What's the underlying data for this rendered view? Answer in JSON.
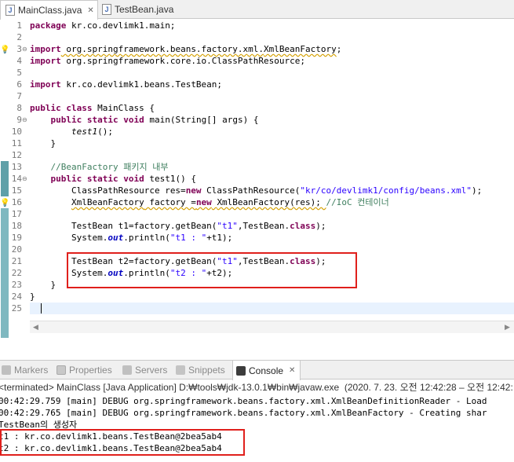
{
  "editor_tabs": [
    {
      "label": "MainClass.java",
      "close": "✕"
    },
    {
      "label": "TestBean.java"
    }
  ],
  "line_numbers": [
    "1",
    "2",
    "3",
    "4",
    "5",
    "6",
    "7",
    "8",
    "9",
    "10",
    "11",
    "12",
    "13",
    "14",
    "15",
    "16",
    "17",
    "18",
    "19",
    "20",
    "21",
    "22",
    "23",
    "24",
    "25"
  ],
  "code": {
    "l1": {
      "a": "package",
      "b": " kr.co.devlimk1.main;"
    },
    "l3": {
      "a": "import",
      "b": " org.springframework.beans.factory.xml.",
      "c": "XmlBeanFactory",
      "d": ";"
    },
    "l4": {
      "a": "import",
      "b": " org.springframework.core.io.ClassPathResource;"
    },
    "l6": {
      "a": "import",
      "b": " kr.co.devlimk1.beans.TestBean;"
    },
    "l8": {
      "a": "public",
      "b": "class",
      "c": " MainClass {"
    },
    "l9": {
      "indent": "    ",
      "a": "public",
      "b": "static",
      "c": "void",
      "d": " main(String[] args) {"
    },
    "l10": {
      "indent": "        ",
      "a": "test1",
      "b": "();"
    },
    "l11": {
      "text": "    }"
    },
    "l13": {
      "indent": "    ",
      "comment": "//BeanFactory 패키지 내부"
    },
    "l14": {
      "indent": "    ",
      "a": "public",
      "b": "static",
      "c": "void",
      "d": " test1() {"
    },
    "l15": {
      "indent": "        ",
      "a": "ClassPathResource res=",
      "b": "new",
      "c": " ClassPathResource(",
      "d": "\"kr/co/devlimk1/config/beans.xml\"",
      "e": ");"
    },
    "l16": {
      "indent": "        ",
      "a": "XmlBeanFactory",
      "b": " factory =",
      "c": "new",
      "d": " ",
      "e": "XmlBeanFactory",
      "f": "(res); ",
      "g": "//IoC 컨테이너"
    },
    "l18": {
      "indent": "        ",
      "a": "TestBean t1=factory.getBean(",
      "b": "\"t1\"",
      "c": ",TestBean.",
      "d": "class",
      "e": ");"
    },
    "l19": {
      "indent": "        ",
      "a": "System.",
      "b": "out",
      "c": ".println(",
      "d": "\"t1 : \"",
      "e": "+t1);"
    },
    "l21": {
      "indent": "        ",
      "a": "TestBean t2=factory.getBean(",
      "b": "\"t1\"",
      "c": ",TestBean.",
      "d": "class",
      "e": ");"
    },
    "l22": {
      "indent": "        ",
      "a": "System.",
      "b": "out",
      "c": ".println(",
      "d": "\"t2 : \"",
      "e": "+t2);"
    },
    "l23": {
      "text": "    }"
    },
    "l24": {
      "text": "}"
    }
  },
  "views": {
    "markers": "Markers",
    "properties": "Properties",
    "servers": "Servers",
    "snippets": "Snippets",
    "console": "Console",
    "console_close": "✕"
  },
  "console": {
    "title": "<terminated> MainClass [Java Application] D:₩tools₩jdk-13.0.1₩bin₩javaw.exe  (2020. 7. 23. 오전 12:42:28 – 오전 12:42:",
    "lines": [
      "00:42:29.759 [main] DEBUG org.springframework.beans.factory.xml.XmlBeanDefinitionReader - Load",
      "00:42:29.765 [main] DEBUG org.springframework.beans.factory.xml.XmlBeanFactory - Creating shar",
      "TestBean의 생성자",
      "t1 : kr.co.devlimk1.beans.TestBean@2bea5ab4",
      "t2 : kr.co.devlimk1.beans.TestBean@2bea5ab4"
    ]
  },
  "colors": {
    "keyword": "#7f0055",
    "string": "#2a00ff",
    "comment": "#3f7f5f",
    "field": "#0000c0",
    "highlight_box": "#e0201c",
    "change_marker": "#5fa0a8"
  }
}
